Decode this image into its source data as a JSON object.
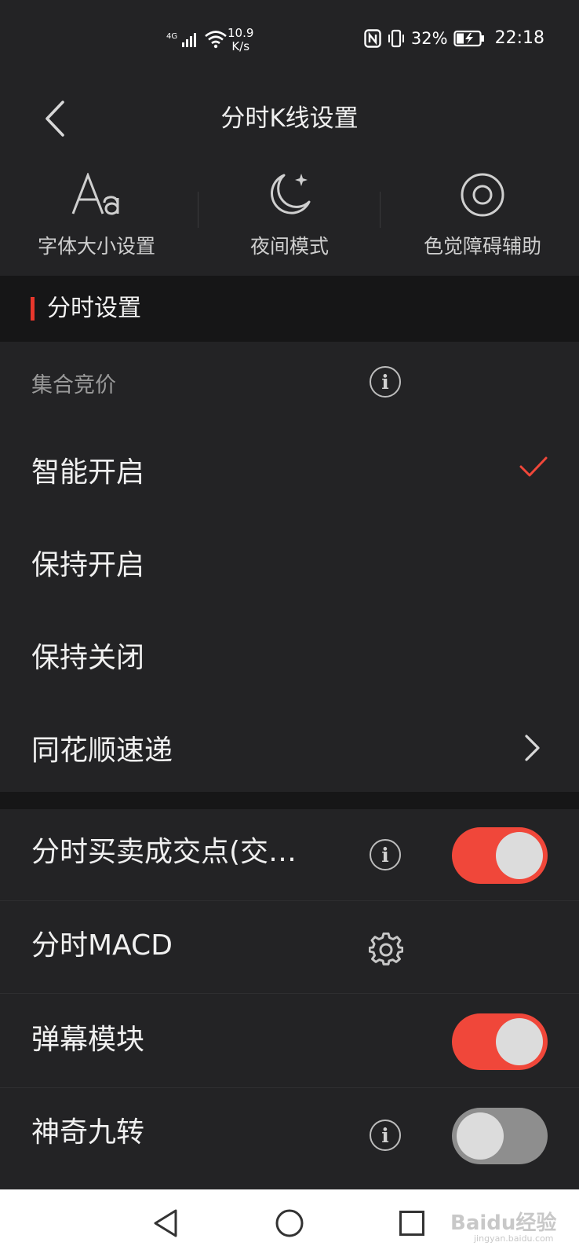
{
  "status_bar": {
    "network": "4G",
    "speed_value": "10.9",
    "speed_unit": "K/s",
    "battery": "32%",
    "time": "22:18"
  },
  "header": {
    "title": "分时K线设置"
  },
  "quick_settings": [
    {
      "label": "字体大小设置",
      "icon": "font-size-icon"
    },
    {
      "label": "夜间模式",
      "icon": "moon-icon"
    },
    {
      "label": "色觉障碍辅助",
      "icon": "target-circle-icon"
    }
  ],
  "section": {
    "title": "分时设置"
  },
  "auction": {
    "label": "集合竞价",
    "options": [
      {
        "label": "智能开启",
        "selected": true
      },
      {
        "label": "保持开启",
        "selected": false
      },
      {
        "label": "保持关闭",
        "selected": false
      }
    ]
  },
  "express": {
    "label": "同花顺速递"
  },
  "toggles": [
    {
      "label": "分时买卖成交点(交…",
      "on": true
    },
    {
      "label": "分时MACD"
    },
    {
      "label": "弹幕模块",
      "on": true
    },
    {
      "label": "神奇九转",
      "on": false
    }
  ],
  "watermark": {
    "text": "Baidu经验",
    "sub": "jingyan.baidu.com"
  },
  "colors": {
    "accent": "#f0473a",
    "background": "#232325",
    "section_band": "#161617"
  }
}
